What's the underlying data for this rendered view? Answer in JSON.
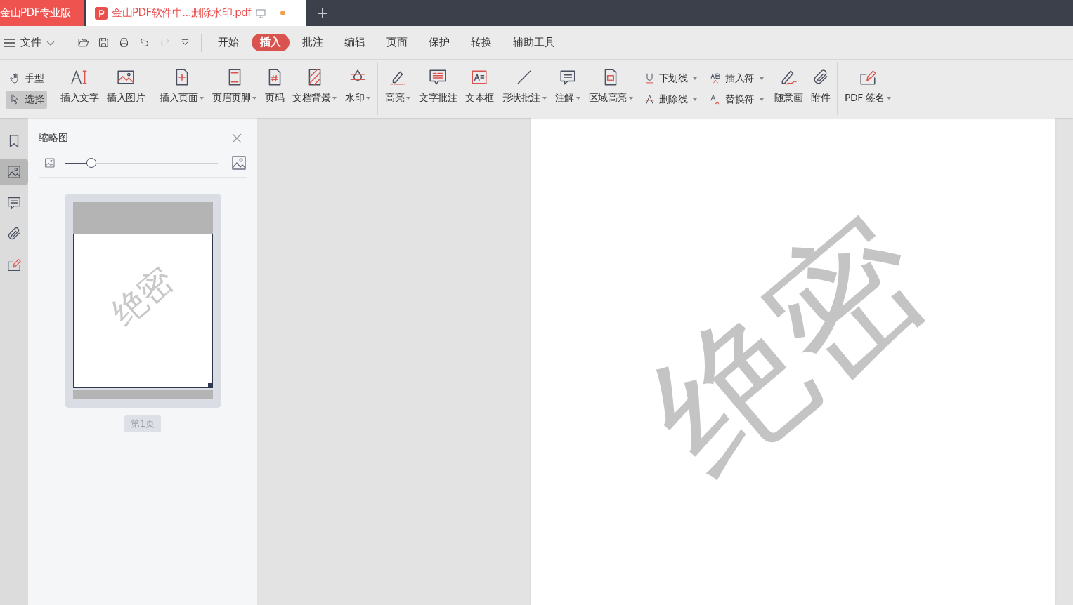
{
  "tabs": [
    {
      "kind": "app",
      "label": "金山PDF专业版",
      "selected": false
    },
    {
      "kind": "doc",
      "label": "金山PDF软件中...删除水印.pdf",
      "selected": true,
      "modified": true
    }
  ],
  "menu": {
    "file_label": "文件",
    "quick_tools": [
      {
        "disabled": false
      },
      {
        "disabled": false
      },
      {
        "disabled": false
      },
      {
        "disabled": false
      },
      {
        "disabled": true
      },
      {
        "disabled": false
      }
    ],
    "tabs": [
      {
        "label": "开始",
        "selected": false
      },
      {
        "label": "插入",
        "selected": true
      },
      {
        "label": "批注",
        "selected": false
      },
      {
        "label": "编辑",
        "selected": false
      },
      {
        "label": "页面",
        "selected": false
      },
      {
        "label": "保护",
        "selected": false
      },
      {
        "label": "转换",
        "selected": false
      },
      {
        "label": "辅助工具",
        "selected": false
      }
    ]
  },
  "ribbon": [
    {
      "items": [
        {
          "kind": "pair",
          "rows": [
            {
              "label": "手型",
              "dropdown": false,
              "selected": false
            },
            {
              "label": "选择",
              "dropdown": false,
              "selected": true
            }
          ]
        }
      ]
    },
    {
      "items": [
        {
          "kind": "big",
          "label": "插入文字",
          "dropdown": false
        },
        {
          "kind": "big",
          "label": "插入图片",
          "dropdown": false
        }
      ]
    },
    {
      "items": [
        {
          "kind": "big",
          "label": "插入页面",
          "dropdown": true
        },
        {
          "kind": "big",
          "label": "页眉页脚",
          "dropdown": true
        },
        {
          "kind": "big",
          "label": "页码",
          "dropdown": false
        },
        {
          "kind": "big",
          "label": "文档背景",
          "dropdown": true
        },
        {
          "kind": "big",
          "label": "水印",
          "dropdown": true
        }
      ]
    },
    {
      "items": [
        {
          "kind": "big",
          "label": "高亮",
          "dropdown": true
        },
        {
          "kind": "big",
          "label": "文字批注",
          "dropdown": false
        },
        {
          "kind": "big",
          "label": "文本框",
          "dropdown": false
        },
        {
          "kind": "big",
          "label": "形状批注",
          "dropdown": true
        },
        {
          "kind": "big",
          "label": "注解",
          "dropdown": true
        },
        {
          "kind": "big",
          "label": "区域高亮",
          "dropdown": true
        },
        {
          "kind": "pair",
          "rows": [
            {
              "label": "下划线",
              "dropdown": true,
              "selected": false
            },
            {
              "label": "删除线",
              "dropdown": true,
              "selected": false
            }
          ]
        },
        {
          "kind": "pair",
          "rows": [
            {
              "label": "插入符",
              "dropdown": true,
              "selected": false
            },
            {
              "label": "替换符",
              "dropdown": true,
              "selected": false
            }
          ]
        },
        {
          "kind": "big",
          "label": "随意画",
          "dropdown": false
        },
        {
          "kind": "big",
          "label": "附件",
          "dropdown": false
        }
      ]
    },
    {
      "items": [
        {
          "kind": "big",
          "label": "PDF 签名",
          "dropdown": true
        }
      ]
    }
  ],
  "side_rail": [
    {
      "selected": false
    },
    {
      "selected": true
    },
    {
      "selected": false
    },
    {
      "selected": false
    },
    {
      "selected": false
    }
  ],
  "thumbnail_panel": {
    "title": "缩略图",
    "zoom": {
      "level": 0.17
    },
    "pages": [
      {
        "label": "第1页",
        "watermark": "绝密",
        "selected": true
      }
    ]
  },
  "document": {
    "watermark": "绝密"
  }
}
